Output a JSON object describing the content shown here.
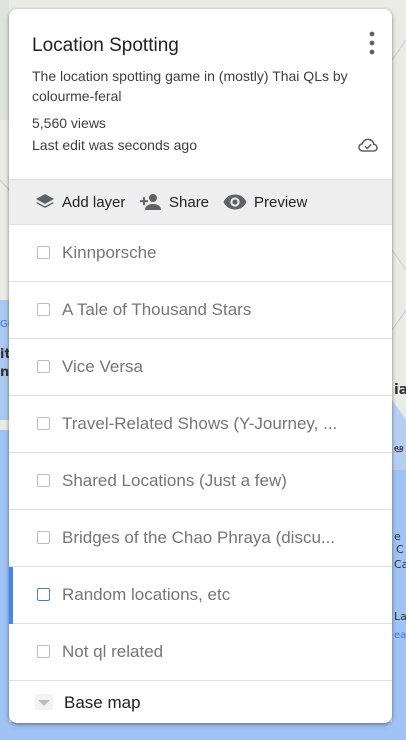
{
  "map": {
    "water_color": "#9fc3f5",
    "land_color": "#e9ece5",
    "partial_labels": {
      "top_right": "T",
      "left_1": "Gu",
      "left_2": "it",
      "left_3": "n",
      "right_1": "ia",
      "right_2": "ఆ",
      "right_3": "e",
      "right_4": "C",
      "right_5": "Ca",
      "right_6": "Lai",
      "right_7": "ea"
    }
  },
  "panel": {
    "title": "Location Spotting",
    "description": "The location spotting game in (mostly) Thai QLs by colourme-feral",
    "views": "5,560 views",
    "last_edit": "Last edit was seconds ago",
    "menu_icon": "more-vert-icon",
    "cloud_icon": "cloud-done-icon"
  },
  "toolbar": {
    "add_layer_label": "Add layer",
    "share_label": "Share",
    "preview_label": "Preview"
  },
  "layers": [
    {
      "label": "Kinnporsche",
      "checked": false,
      "active": false
    },
    {
      "label": "A Tale of Thousand Stars",
      "checked": false,
      "active": false
    },
    {
      "label": "Vice Versa",
      "checked": false,
      "active": false
    },
    {
      "label": "Travel-Related Shows (Y-Journey, ...",
      "checked": false,
      "active": false
    },
    {
      "label": "Shared Locations (Just a few)",
      "checked": false,
      "active": false
    },
    {
      "label": "Bridges of the Chao Phraya (discu...",
      "checked": false,
      "active": false
    },
    {
      "label": "Random locations, etc",
      "checked": false,
      "active": true
    },
    {
      "label": "Not ql related",
      "checked": false,
      "active": false
    }
  ],
  "basemap": {
    "label": "Base map"
  },
  "colors": {
    "active_bar": "#4285f4",
    "toolbar_bg": "#eeeeee",
    "text_muted": "#757575"
  }
}
